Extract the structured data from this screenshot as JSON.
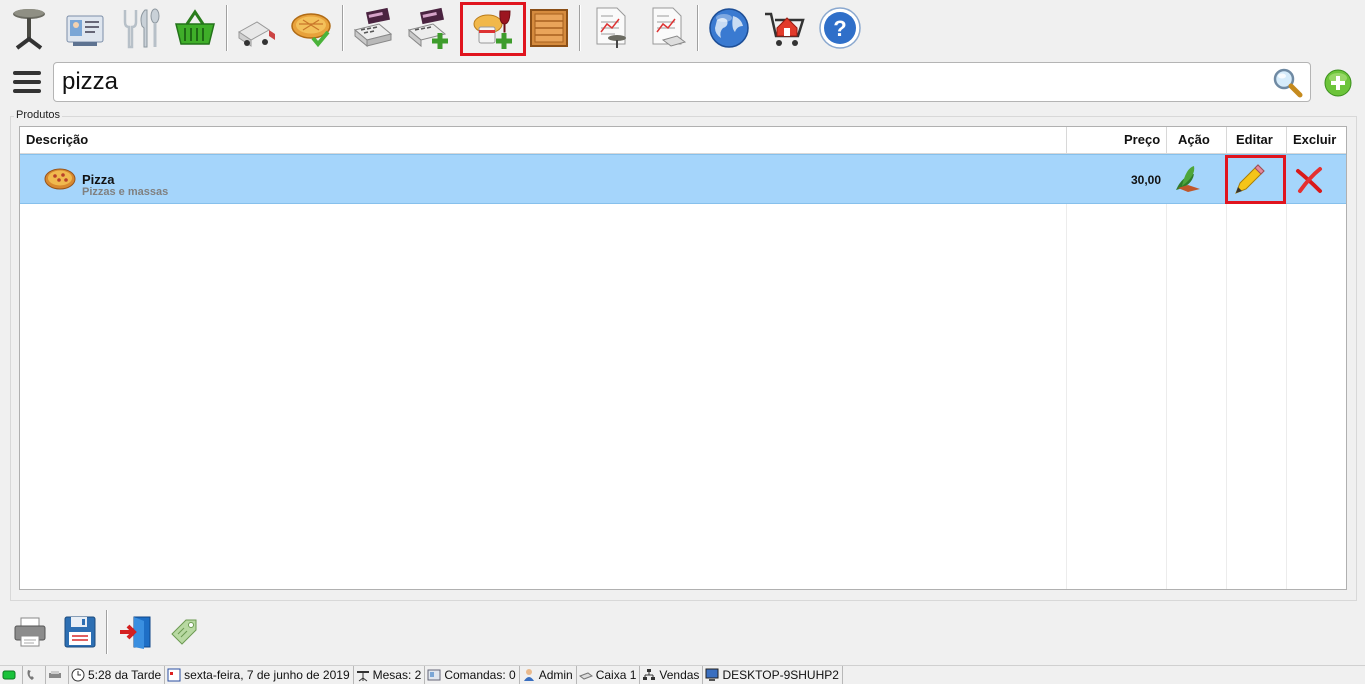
{
  "toolbar": {
    "buttons": [
      {
        "icon": "table-icon"
      },
      {
        "icon": "contact-card-icon"
      },
      {
        "icon": "cutlery-icon"
      },
      {
        "icon": "shopping-basket-icon"
      },
      {
        "icon": "delivery-truck-icon"
      },
      {
        "icon": "pizza-check-icon"
      },
      {
        "icon": "cash-register-icon"
      },
      {
        "icon": "cash-register-add-icon"
      },
      {
        "icon": "food-drink-add-icon",
        "highlighted": true
      },
      {
        "icon": "wooden-crate-icon"
      },
      {
        "icon": "report-table-icon"
      },
      {
        "icon": "report-cash-icon"
      },
      {
        "icon": "globe-icon"
      },
      {
        "icon": "shop-cart-icon"
      },
      {
        "icon": "help-icon"
      }
    ]
  },
  "search": {
    "value": "pizza"
  },
  "products": {
    "group_label": "Produtos",
    "columns": {
      "descricao": "Descrição",
      "preco": "Preço",
      "acao": "Ação",
      "editar": "Editar",
      "excluir": "Excluir"
    },
    "rows": [
      {
        "name": "Pizza",
        "category": "Pizzas e massas",
        "price": "30,00"
      }
    ]
  },
  "status": {
    "time": "5:28 da Tarde",
    "date": "sexta-feira, 7 de junho de 2019",
    "mesas": "Mesas: 2",
    "comandas": "Comandas: 0",
    "user": "Admin",
    "caixa": "Caixa 1",
    "vendas": "Vendas",
    "computer": "DESKTOP-9SHUHP2"
  },
  "colors": {
    "highlight": "#e0141e",
    "selected_row": "#a5d5fb"
  }
}
